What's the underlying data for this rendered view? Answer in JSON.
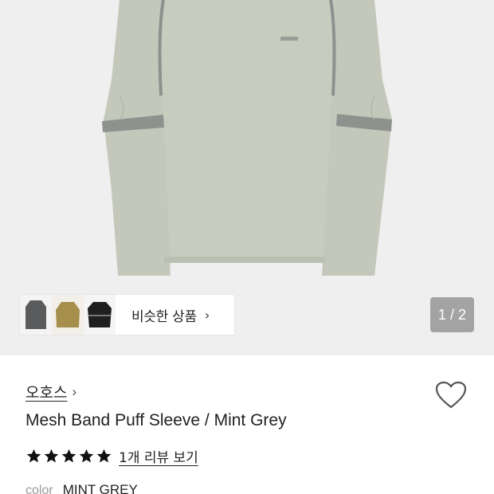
{
  "gallery": {
    "counter": "1 / 2",
    "similar_label": "비슷한 상품",
    "thumbnails": [
      "charcoal-jacket",
      "mustard-sweater",
      "black-top"
    ],
    "brand_colors": {
      "garment": "#c9cdbf",
      "band": "#8e918e",
      "background": "#efefef"
    }
  },
  "product": {
    "brand": "오호스",
    "title": "Mesh Band Puff Sleeve / Mint Grey",
    "rating": 5,
    "review_link": "1개 리뷰 보기",
    "color_label": "color",
    "color_value": "MINT GREY"
  }
}
